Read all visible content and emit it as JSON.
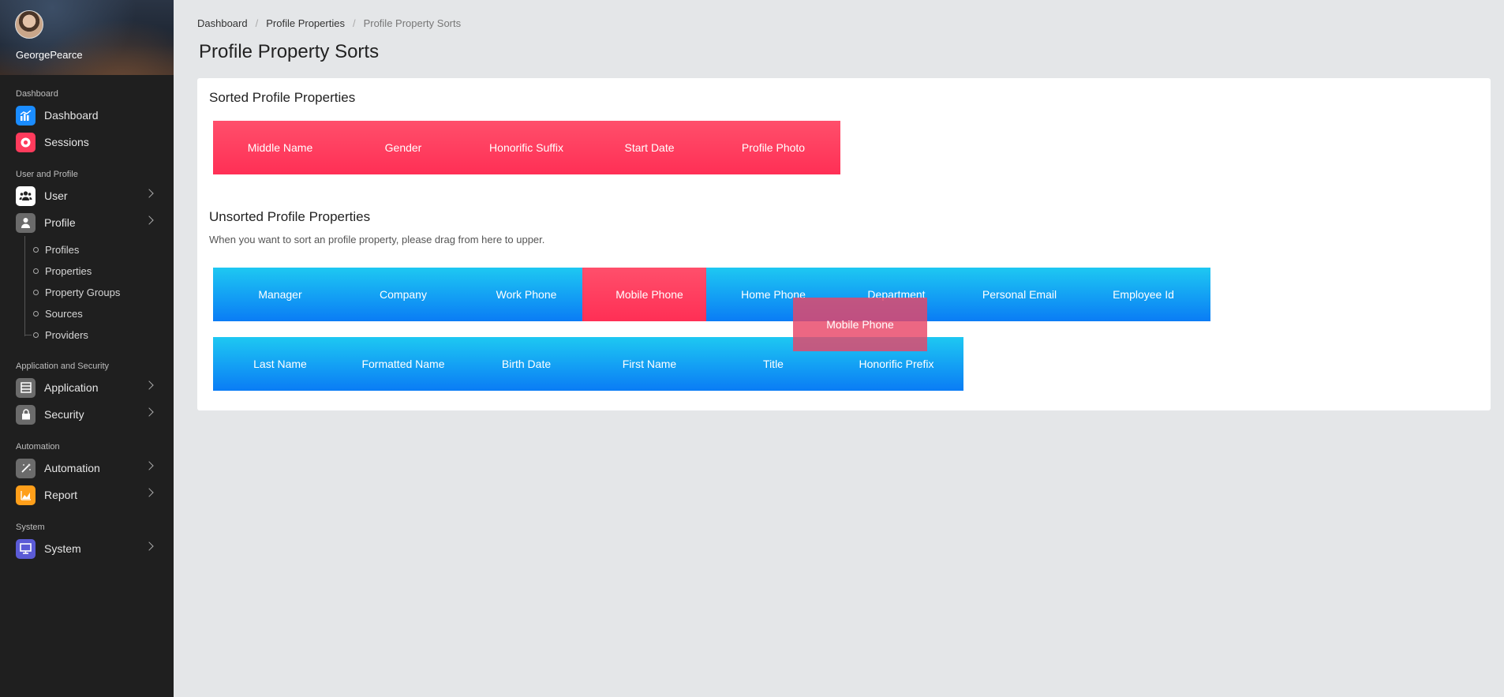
{
  "user": {
    "name": "GeorgePearce"
  },
  "sidebar": {
    "sections": [
      {
        "label": "Dashboard",
        "items": [
          {
            "label": "Dashboard",
            "icon": "chart-icon",
            "color": "#1a8cff",
            "expandable": false
          },
          {
            "label": "Sessions",
            "icon": "record-icon",
            "color": "#ff3b5c",
            "expandable": false
          }
        ]
      },
      {
        "label": "User and Profile",
        "items": [
          {
            "label": "User",
            "icon": "users-icon",
            "color": "#ffffff",
            "expandable": true
          },
          {
            "label": "Profile",
            "icon": "person-icon",
            "color": "#6b6b6b",
            "expandable": true
          }
        ]
      },
      {
        "label": "Application and Security",
        "items": [
          {
            "label": "Application",
            "icon": "app-icon",
            "color": "#6b6b6b",
            "expandable": true
          },
          {
            "label": "Security",
            "icon": "lock-icon",
            "color": "#6b6b6b",
            "expandable": true
          }
        ]
      },
      {
        "label": "Automation",
        "items": [
          {
            "label": "Automation",
            "icon": "wand-icon",
            "color": "#6b6b6b",
            "expandable": true
          },
          {
            "label": "Report",
            "icon": "area-chart-icon",
            "color": "#ff9f1a",
            "expandable": true
          }
        ]
      },
      {
        "label": "System",
        "items": [
          {
            "label": "System",
            "icon": "monitor-icon",
            "color": "#5b5bd6",
            "expandable": true
          }
        ]
      }
    ],
    "profile_subitems": [
      "Profiles",
      "Properties",
      "Property Groups",
      "Sources",
      "Providers"
    ]
  },
  "breadcrumb": [
    "Dashboard",
    "Profile Properties",
    "Profile Property Sorts"
  ],
  "page_title": "Profile Property Sorts",
  "sorted": {
    "title": "Sorted Profile Properties",
    "items": [
      "Middle Name",
      "Gender",
      "Honorific Suffix",
      "Start Date",
      "Profile Photo"
    ]
  },
  "unsorted": {
    "title": "Unsorted Profile Properties",
    "hint": "When you want to sort an profile property, please drag from here to upper.",
    "row1": [
      "Manager",
      "Company",
      "Work Phone",
      "Mobile Phone",
      "Home Phone",
      "Department",
      "Personal Email",
      "Employee Id"
    ],
    "row2": [
      "Last Name",
      "Formatted Name",
      "Birth Date",
      "First Name",
      "Title",
      "Honorific Prefix"
    ],
    "dragging": "Mobile Phone"
  },
  "colors": {
    "sorted_tile": "#ff3b5c",
    "unsorted_tile": "#1090f5",
    "drag_ghost": "#e84668"
  }
}
